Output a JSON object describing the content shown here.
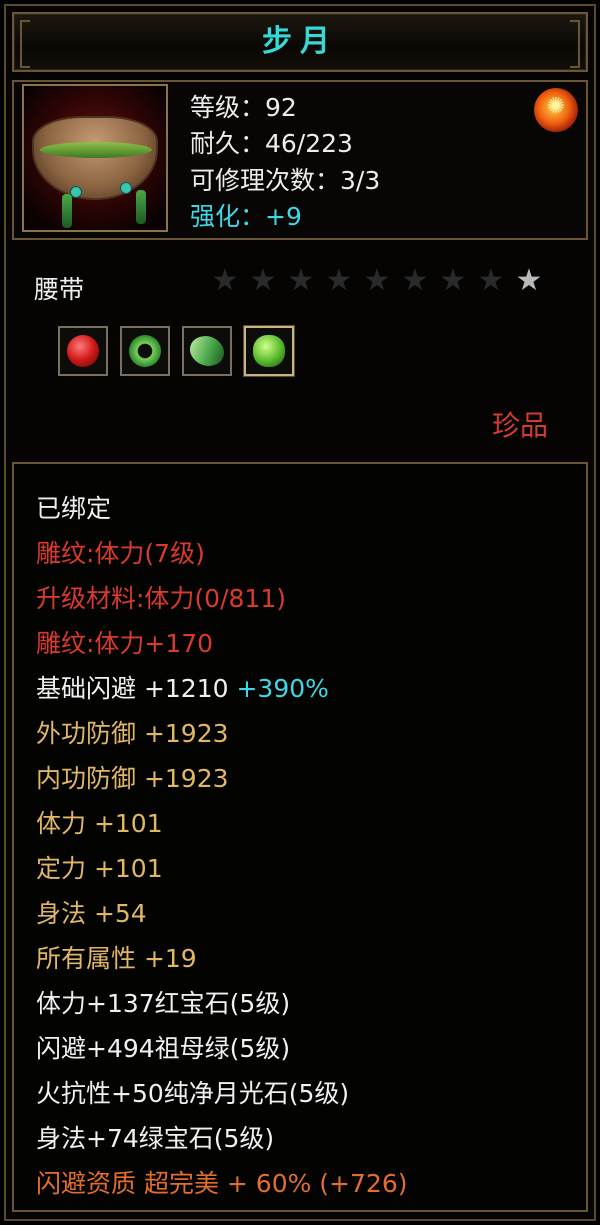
{
  "item": {
    "name": "步月",
    "level_line": "等级：92",
    "durability_line": "耐久：46/223",
    "repair_line": "可修理次数：3/3",
    "enhance_line": "强化：+9",
    "type": "腰带",
    "rarity": "珍品",
    "stars_total": 9,
    "stars_lit": 1,
    "icon": "belt-icon",
    "badge_icon": "fire-element-icon"
  },
  "gems": [
    {
      "name": "red-gem-socket",
      "kind": "red"
    },
    {
      "name": "jade-ring-socket",
      "kind": "jade"
    },
    {
      "name": "green-leaf-gem-socket",
      "kind": "leaf"
    },
    {
      "name": "green-gem-socket",
      "kind": "green"
    }
  ],
  "attributes": [
    {
      "text": "已绑定",
      "color": "white"
    },
    {
      "text": "雕纹:体力(7级)",
      "color": "red"
    },
    {
      "text": "升级材料:体力(0/811)",
      "color": "red"
    },
    {
      "text": "雕纹:体力+170",
      "color": "red"
    },
    {
      "text": "基础闪避  +1210",
      "extra": "+390%",
      "color": "white"
    },
    {
      "text": "外功防御  +1923",
      "color": "gold"
    },
    {
      "text": "内功防御  +1923",
      "color": "gold"
    },
    {
      "text": "体力  +101",
      "color": "gold"
    },
    {
      "text": "定力  +101",
      "color": "gold"
    },
    {
      "text": "身法  +54",
      "color": "gold"
    },
    {
      "text": "所有属性  +19",
      "color": "gold"
    },
    {
      "text": "体力+137红宝石(5级)",
      "color": "white"
    },
    {
      "text": "闪避+494祖母绿(5级)",
      "color": "white"
    },
    {
      "text": "火抗性+50纯净月光石(5级)",
      "color": "white"
    },
    {
      "text": "身法+74绿宝石(5级)",
      "color": "white"
    },
    {
      "text": "闪避资质  超完美  + 60% (+726)",
      "color": "orange"
    }
  ],
  "colors": {
    "title": "#35d9d6",
    "enhance": "#3fd6e6",
    "red": "#d83a2e",
    "gold": "#e0b765",
    "orange": "#e36e2c",
    "border": "#6a5636"
  }
}
